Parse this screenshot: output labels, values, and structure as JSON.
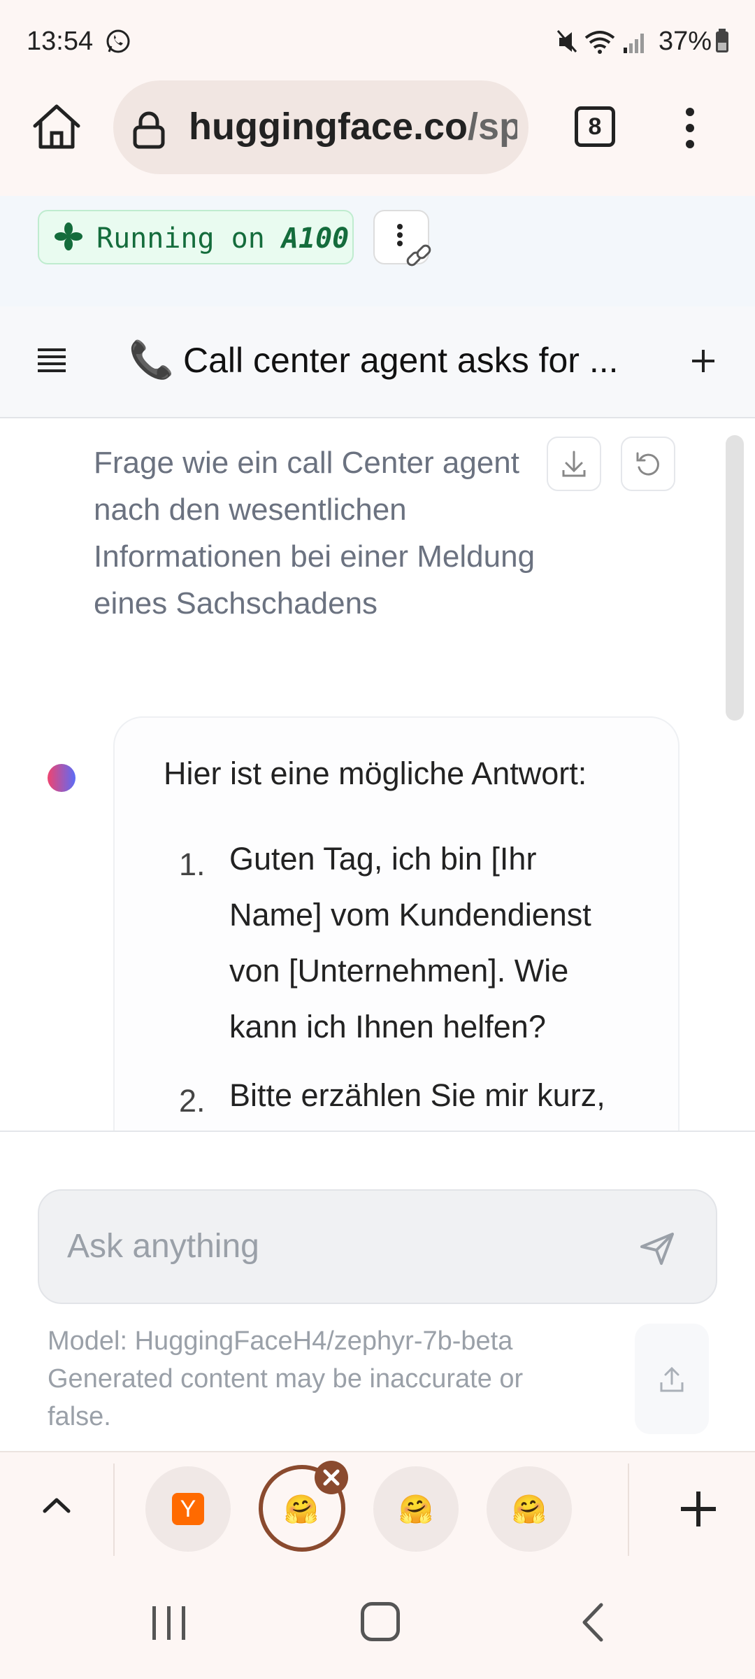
{
  "status_bar": {
    "time": "13:54",
    "battery": "37%",
    "icons": [
      "whatsapp-icon",
      "mute-icon",
      "wifi-icon",
      "signal-icon",
      "battery-icon"
    ]
  },
  "browser": {
    "url_host": "huggingface.co",
    "url_path": "/sp",
    "tab_count": "8"
  },
  "space": {
    "status_prefix": "Running on ",
    "hardware": "A100"
  },
  "chat": {
    "title": "Call center agent asks for ...",
    "title_emoji": "📞",
    "user_message": "Frage wie ein call Center agent nach den wesentlichen Informationen bei einer Meldung eines Sachschadens",
    "assistant": {
      "intro": "Hier ist eine mögliche Antwort:",
      "items": [
        {
          "num": "1.",
          "text": "Guten Tag, ich bin [Ihr Name] vom Kundendienst von [Unternehmen]. Wie kann ich Ihnen helfen?"
        },
        {
          "num": "2.",
          "text": "Bitte erzählen Sie mir kurz,"
        }
      ]
    }
  },
  "input": {
    "placeholder": "Ask anything",
    "model_info": "Model: HuggingFaceH4/zephyr-7b-beta",
    "disclaimer": "Generated content may be inaccurate or false."
  },
  "tab_strip": {
    "first_tab_letter": "Y",
    "hf_emoji": "🤗"
  },
  "colors": {
    "accent_green": "#146c3c",
    "active_tab_ring": "#8a4a2e",
    "browser_bg": "#fdf6f4"
  }
}
